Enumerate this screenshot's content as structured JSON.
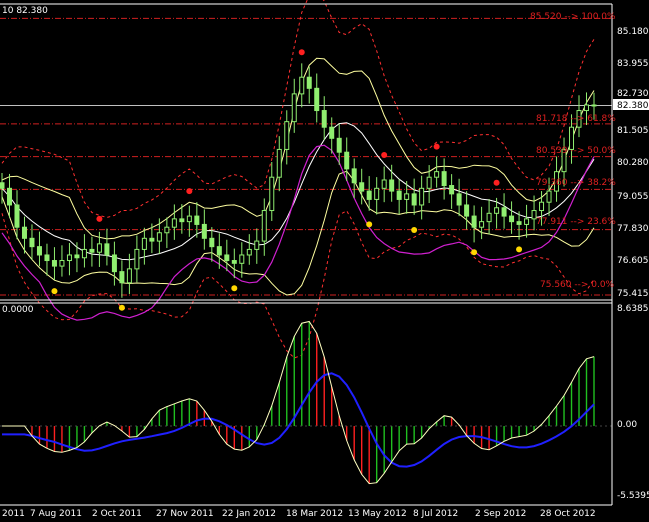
{
  "header": {
    "main_readout": "10 82.380",
    "sub_readout": "0.0000"
  },
  "price_axis": {
    "ticks": [
      "85.180",
      "83.955",
      "82.730",
      "81.505",
      "80.280",
      "79.055",
      "77.830",
      "76.605",
      "75.415"
    ],
    "current_price_label": "82.380"
  },
  "indicator_axis": {
    "ticks": [
      "8.6385",
      "0.00",
      "-5.5395"
    ]
  },
  "time_axis": {
    "labels": [
      "2011",
      "7 Aug 2011",
      "2 Oct 2011",
      "27 Nov 2011",
      "22 Jan 2012",
      "18 Mar 2012",
      "13 May 2012",
      "8 Jul 2012",
      "2 Sep 2012",
      "28 Oct 2012"
    ]
  },
  "fib_levels": [
    {
      "label": "85.520 --> 100.0%"
    },
    {
      "label": "81.718 --> 61.8%"
    },
    {
      "label": "80.539 --> 50.0%"
    },
    {
      "label": "79.360 --> 38.2%"
    },
    {
      "label": "77.911 --> 23.6%"
    },
    {
      "label": "75.560 --> 0.0%"
    }
  ],
  "colors": {
    "background": "#000000",
    "grid": "#ffffff",
    "candle": "#90ee70",
    "bb_outer": "#ff3030",
    "bb_mid": "#ffffff",
    "envelope": "#ffffa0",
    "ma_slow": "#d020d0",
    "fractal_up": "#ff2020",
    "fractal_down": "#ffd700",
    "hist_up": "#20c020",
    "hist_down": "#ff2020",
    "signal_blue": "#2020ff",
    "osc_white": "#ffffc0"
  },
  "chart_data": {
    "type": "line",
    "ohlc_close": [
      79.4,
      78.8,
      78.0,
      77.6,
      77.3,
      77.0,
      76.8,
      76.6,
      76.8,
      77.0,
      76.9,
      77.2,
      77.1,
      77.4,
      77.0,
      76.4,
      76.0,
      76.5,
      77.2,
      77.6,
      77.5,
      77.8,
      78.0,
      78.3,
      78.2,
      78.4,
      78.1,
      77.6,
      77.3,
      77.0,
      76.8,
      76.7,
      77.0,
      77.2,
      77.5,
      78.6,
      79.8,
      80.8,
      81.8,
      82.8,
      83.4,
      83.0,
      82.2,
      81.6,
      81.2,
      80.7,
      80.1,
      79.6,
      79.3,
      79.0,
      79.4,
      79.7,
      79.3,
      79.0,
      79.2,
      78.8,
      79.4,
      79.8,
      80.0,
      79.5,
      79.2,
      78.8,
      78.4,
      78.0,
      78.2,
      78.5,
      78.7,
      78.4,
      78.2,
      78.1,
      78.3,
      78.6,
      78.9,
      79.3,
      80.0,
      80.8,
      81.6,
      82.2,
      82.4,
      82.4
    ],
    "ylim": [
      75.415,
      86.0
    ],
    "oscillator_range": [
      -5.5395,
      8.6385
    ]
  }
}
